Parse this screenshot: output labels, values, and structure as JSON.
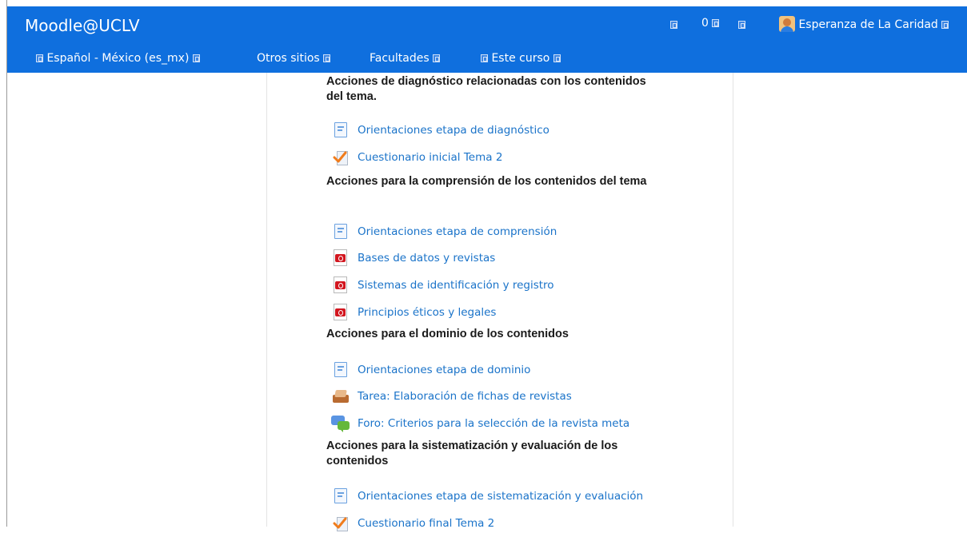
{
  "header": {
    "brand": "Moodle@UCLV",
    "notification_count": "0",
    "user_name": "Esperanza de La Caridad"
  },
  "nav": {
    "language": "Español - México (es_mx)",
    "other_sites": "Otros sitios",
    "faculties": "Facultades",
    "this_course": "Este curso"
  },
  "sections": [
    {
      "heading": "Acciones de diagnóstico relacionadas con los contenidos del tema.",
      "activities": [
        {
          "icon": "page-icon",
          "label": "Orientaciones etapa de diagnóstico"
        },
        {
          "icon": "quiz-icon",
          "label": "Cuestionario inicial Tema 2"
        }
      ]
    },
    {
      "heading": "Acciones para la comprensión de los contenidos del tema",
      "activities": [
        {
          "icon": "page-icon",
          "label": "Orientaciones etapa de comprensión"
        },
        {
          "icon": "pdf-icon",
          "label": "Bases de datos y revistas"
        },
        {
          "icon": "pdf-icon",
          "label": "Sistemas de identificación y registro"
        },
        {
          "icon": "pdf-icon",
          "label": "Principios éticos y legales"
        }
      ]
    },
    {
      "heading": "Acciones para el dominio de los contenidos",
      "activities": [
        {
          "icon": "page-icon",
          "label": "Orientaciones etapa de dominio"
        },
        {
          "icon": "assignment-icon",
          "label": "Tarea: Elaboración de fichas de revistas"
        },
        {
          "icon": "forum-icon",
          "label": "Foro: Criterios para la selección de la revista meta"
        }
      ]
    },
    {
      "heading": "Acciones para la sistematización y evaluación de los contenidos",
      "activities": [
        {
          "icon": "page-icon",
          "label": "Orientaciones etapa de sistematización y evaluación"
        },
        {
          "icon": "quiz-icon",
          "label": "Cuestionario final Tema 2"
        }
      ]
    }
  ],
  "colors": {
    "header_bg": "#0f6fde",
    "link": "#1a73c9",
    "heading": "#1a1a1a"
  }
}
